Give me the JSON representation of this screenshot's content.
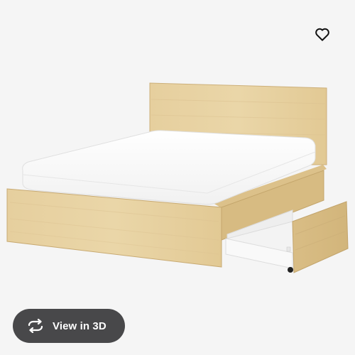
{
  "product": {
    "image_subject": "bed-frame-with-storage-drawers"
  },
  "actions": {
    "favourite_icon": "heart-outline-icon",
    "view_3d_label": "View in 3D",
    "view_3d_icon": "rotate-arrows-icon"
  },
  "colors": {
    "background": "#f5f5f5",
    "button_background": "#48484a",
    "button_text": "#ffffff",
    "icon_dark": "#111111"
  }
}
